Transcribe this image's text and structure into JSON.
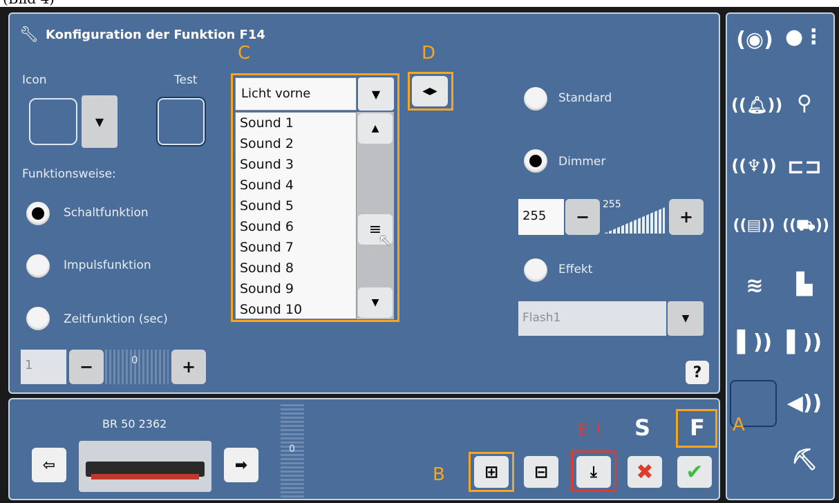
{
  "caption": "(Bild 4)",
  "dialog": {
    "title": "Konfiguration der Funktion F14",
    "icon_label": "Icon",
    "test_label": "Test",
    "mode_label": "Funktionsweise:",
    "modes": [
      {
        "label": "Schaltfunktion",
        "selected": true
      },
      {
        "label": "Impulsfunktion",
        "selected": false
      },
      {
        "label": "Zeitfunktion (sec)",
        "selected": false
      }
    ],
    "time_value": "1",
    "time_slider_value": "0",
    "function_select": {
      "selected": "Licht vorne",
      "options": [
        "Sound 1",
        "Sound 2",
        "Sound 3",
        "Sound 4",
        "Sound 5",
        "Sound 6",
        "Sound 7",
        "Sound 8",
        "Sound 9",
        "Sound 10"
      ]
    },
    "output_modes": [
      {
        "label": "Standard",
        "selected": false
      },
      {
        "label": "Dimmer",
        "selected": true
      },
      {
        "label": "Effekt",
        "selected": false
      }
    ],
    "dimmer_value": "255",
    "dimmer_max": "255",
    "effect_select": "Flash1",
    "help": "?"
  },
  "annotations": {
    "A": "A",
    "B": "B",
    "C": "C",
    "D": "D",
    "E": "E !"
  },
  "loco": {
    "name": "BR 50 2362",
    "speed": "0"
  },
  "bottom": {
    "s_label": "S",
    "f_label": "F"
  },
  "colors": {
    "panel": "#4b6d9a",
    "highlight": "#f5a623",
    "error": "#e03c2e",
    "ok": "#3fbf3f"
  }
}
